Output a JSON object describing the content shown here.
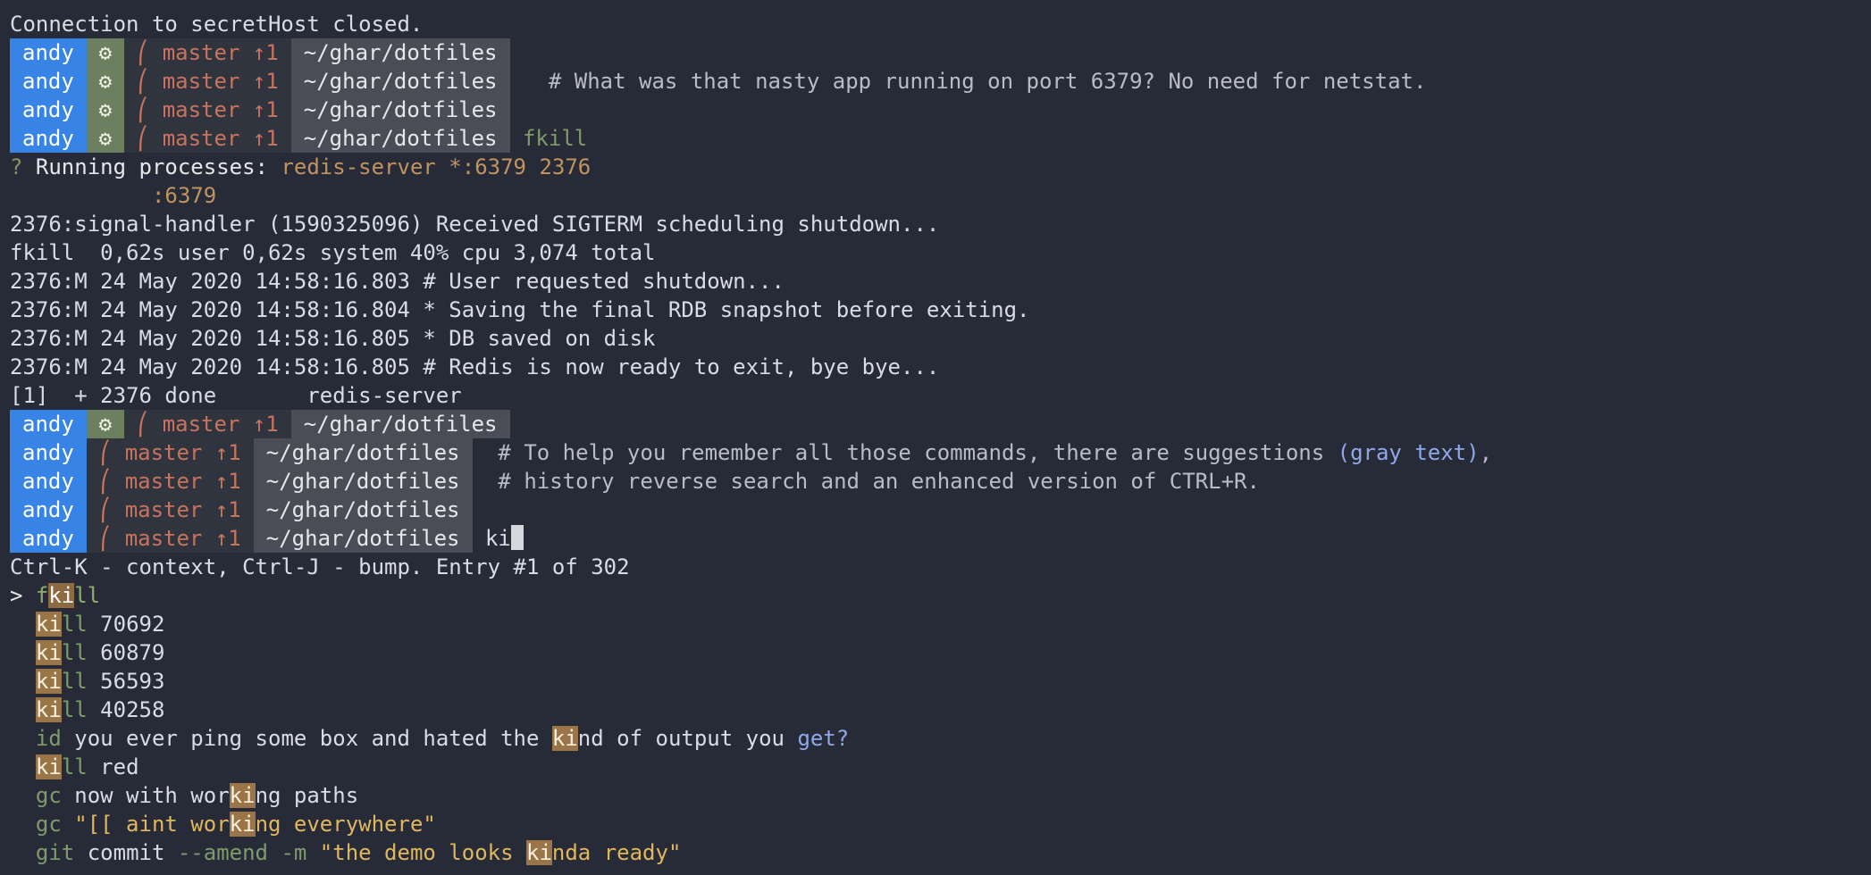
{
  "terminal": {
    "closed_line": "Connection to secretHost closed.",
    "prompt": {
      "user": "andy",
      "git_glyph": "⎛",
      "branch": "master",
      "ahead": "↑1",
      "dir": "~/ghar/dotfiles"
    },
    "comment_netstat": "# What was that nasty app running on port 6379? No need for netstat.",
    "cmd_fkill": "fkill",
    "running_label": "Running processes:",
    "running_value": "redis-server *:6379 2376",
    "running_port": ":6379",
    "output": [
      "2376:signal-handler (1590325096) Received SIGTERM scheduling shutdown...",
      "fkill  0,62s user 0,62s system 40% cpu 3,074 total",
      "2376:M 24 May 2020 14:58:16.803 # User requested shutdown...",
      "2376:M 24 May 2020 14:58:16.804 * Saving the final RDB snapshot before exiting.",
      "2376:M 24 May 2020 14:58:16.805 * DB saved on disk",
      "2376:M 24 May 2020 14:58:16.805 # Redis is now ready to exit, bye bye...",
      "[1]  + 2376 done       redis-server"
    ],
    "comment_suggest_1": "# To help you remember all those commands, there are suggestions",
    "comment_suggest_paren": "(gray text)",
    "comment_suggest_1_end": ",",
    "comment_suggest_2": "# history reverse search and an enhanced version of CTRL+R.",
    "typed_input": "ki",
    "status_line": "Ctrl-K - context, Ctrl-J - bump. Entry #1 of 302",
    "history": [
      {
        "pre": "f",
        "hit": "ki",
        "post": "ll",
        "rest": ""
      },
      {
        "pre": "",
        "hit": "ki",
        "post": "ll",
        "rest": " 70692"
      },
      {
        "pre": "",
        "hit": "ki",
        "post": "ll",
        "rest": " 60879"
      },
      {
        "pre": "",
        "hit": "ki",
        "post": "ll",
        "rest": " 56593"
      },
      {
        "pre": "",
        "hit": "ki",
        "post": "ll",
        "rest": " 40258"
      },
      {
        "cmd": "id",
        "a": " you ever ping some box and hated the ",
        "hit": "ki",
        "b": "nd of output you ",
        "tail": "get?"
      },
      {
        "pre": "",
        "hit": "ki",
        "post": "ll",
        "rest": " red"
      },
      {
        "cmd": "gc",
        "a": " now with wor",
        "hit": "ki",
        "b": "ng paths"
      },
      {
        "cmd": "gc",
        "a": " \"[[ aint wor",
        "hit": "ki",
        "b": "ng everywhere\""
      },
      {
        "cmd": "git",
        "a": " commit ",
        "flag": "--amend -m",
        "q1": " \"the demo looks ",
        "hit": "ki",
        "q2": "nda ready\""
      }
    ],
    "selected_marker": ">"
  },
  "colors": {
    "background": "#272b38",
    "user_segment": "#3784e6",
    "gear_segment": "#6c7f5e",
    "git_text": "#c7745c",
    "dir_segment": "#4a4d55",
    "match_highlight": "#9a7548"
  },
  "icons": {
    "gear": "gear-icon",
    "git_branch": "git-branch-icon"
  }
}
